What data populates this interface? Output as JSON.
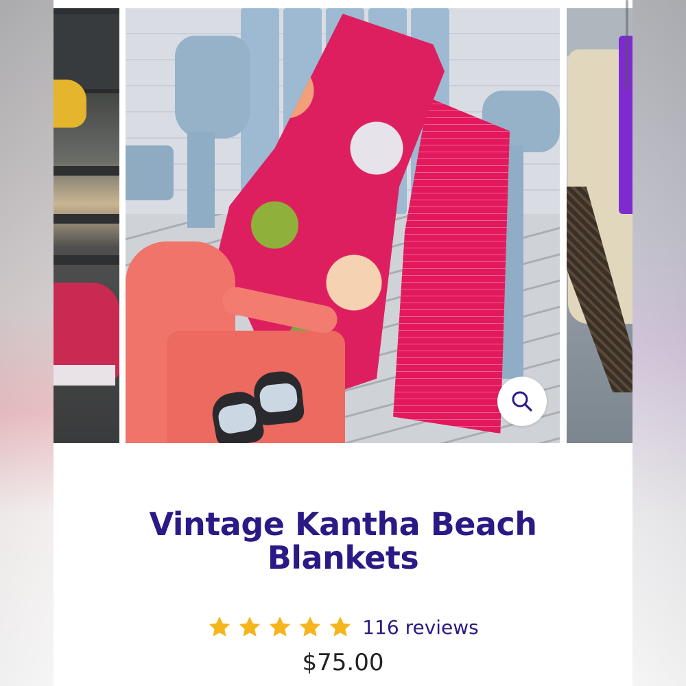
{
  "product": {
    "title_line1": "Vintage Kantha Beach",
    "title_line2": "Blankets",
    "rating_stars": 5,
    "rating_max": 5,
    "reviews_label": "116 reviews",
    "price": "$75.00"
  },
  "gallery": {
    "zoom_icon": "search-icon"
  },
  "colors": {
    "title": "#2b1a85",
    "star": "#f5b51c",
    "price": "#222222"
  }
}
